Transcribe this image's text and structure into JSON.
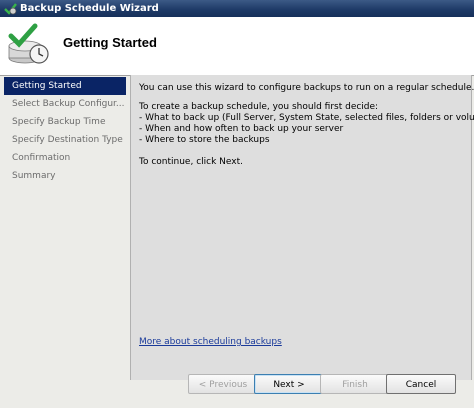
{
  "window": {
    "title": "Backup Schedule Wizard"
  },
  "header": {
    "title": "Getting Started"
  },
  "nav": {
    "items": [
      {
        "label": "Getting Started",
        "active": true
      },
      {
        "label": "Select Backup Configur...",
        "active": false
      },
      {
        "label": "Specify Backup Time",
        "active": false
      },
      {
        "label": "Specify Destination Type",
        "active": false
      },
      {
        "label": "Confirmation",
        "active": false
      },
      {
        "label": "Summary",
        "active": false
      }
    ]
  },
  "content": {
    "intro": "You can use this wizard to configure backups to run on a regular schedule.",
    "decide": "To create a backup schedule, you should first decide:",
    "bullets": [
      "- What to back up (Full Server, System State, selected files, folders or volumes)",
      "- When and how often to back up your server",
      "- Where to store the backups"
    ],
    "continue": "To continue, click Next.",
    "link": "More about scheduling backups"
  },
  "buttons": {
    "previous": "< Previous",
    "next": "Next >",
    "finish": "Finish",
    "cancel": "Cancel"
  },
  "colors": {
    "titlebar": "#1f3b68",
    "nav_active": "#0a2465",
    "link": "#1a3a9a"
  },
  "icons": {
    "app": "backup-icon",
    "header": "backup-schedule-icon"
  }
}
